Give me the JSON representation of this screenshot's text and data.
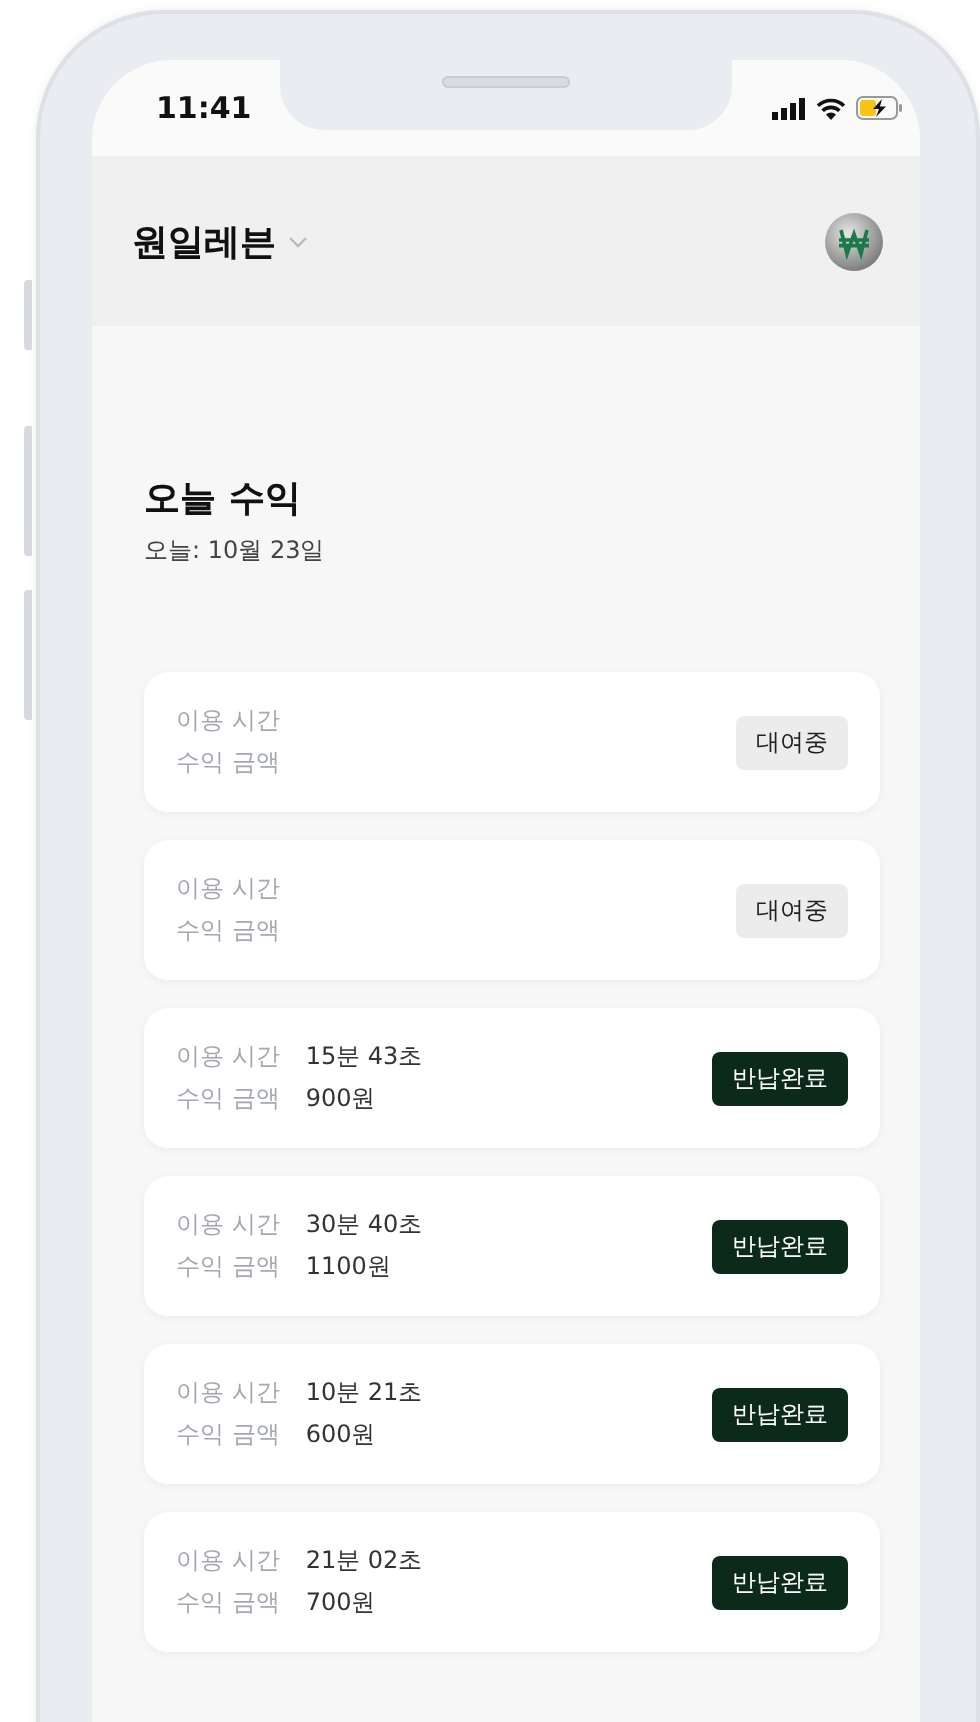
{
  "status_bar": {
    "time": "11:41"
  },
  "header": {
    "title": "원일레븐"
  },
  "summary": {
    "title": "오늘 수익",
    "date": "오늘: 10월 23일"
  },
  "rentals": [
    {
      "time_label": "이용 시간",
      "amount_label": "수익 금액",
      "status": {
        "label": "대여중",
        "kind": "renting"
      }
    },
    {
      "time_label": "이용 시간",
      "amount_label": "수익 금액",
      "status": {
        "label": "대여중",
        "kind": "renting"
      }
    },
    {
      "time_label": "이용 시간",
      "time": "15분 43초",
      "amount_label": "수익 금액",
      "amount": "900원",
      "status": {
        "label": "반납완료",
        "kind": "returned"
      }
    },
    {
      "time_label": "이용 시간",
      "time": "30분 40초",
      "amount_label": "수익 금액",
      "amount": "1100원",
      "status": {
        "label": "반납완료",
        "kind": "returned"
      }
    },
    {
      "time_label": "이용 시간",
      "time": "10분 21초",
      "amount_label": "수익 금액",
      "amount": "600원",
      "status": {
        "label": "반납완료",
        "kind": "returned"
      }
    },
    {
      "time_label": "이용 시간",
      "time": "21분 02초",
      "amount_label": "수익 금액",
      "amount": "700원",
      "status": {
        "label": "반납완료",
        "kind": "returned"
      }
    }
  ]
}
